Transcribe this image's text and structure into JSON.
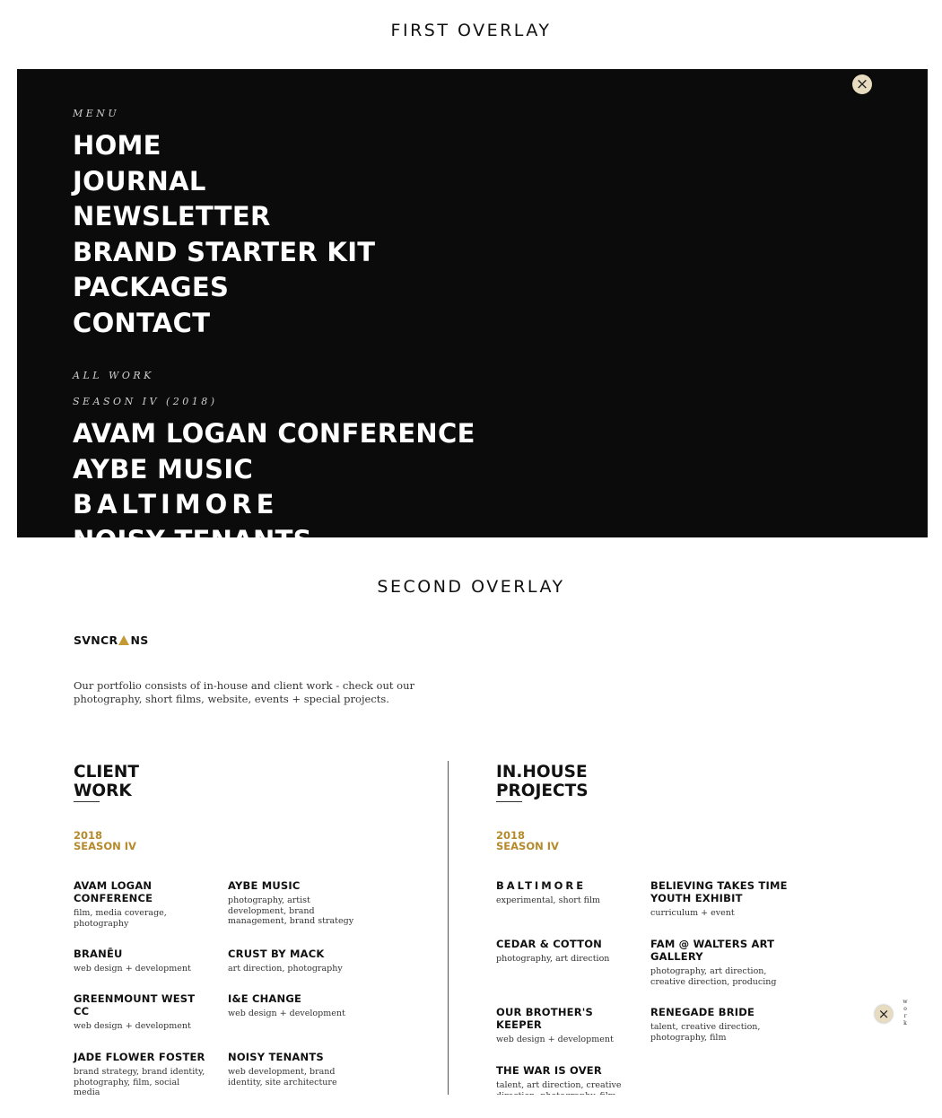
{
  "overlay1": {
    "title": "FIRST OVERLAY",
    "close_icon": "×",
    "menu_label": "MENU",
    "menu_items": [
      "HOME",
      "JOURNAL",
      "NEWSLETTER",
      "BRAND STARTER KIT",
      "PACKAGES",
      "CONTACT"
    ],
    "all_work_label": "ALL WORK",
    "season_label": "SEASON IV (2018)",
    "work_items": [
      "AVAM LOGAN CONFERENCE",
      "AYBE MUSIC",
      "BALTIMORE",
      "NOISY TENANTS"
    ]
  },
  "overlay2": {
    "title": "SECOND OVERLAY",
    "logo": {
      "before": "SVNCR",
      "after": "NS"
    },
    "intro": "Our portfolio consists of in-house and client work - check out our photography, short films, website, events + special projects.",
    "client": {
      "heading": [
        "CLIENT",
        "WORK"
      ],
      "year": "2018",
      "season": "SEASON IV",
      "projects": [
        {
          "title": "AVAM LOGAN CONFERENCE",
          "desc": "film, media coverage, photography"
        },
        {
          "title": "AYBE MUSIC",
          "desc": "photography, artist development, brand management, brand strategy"
        },
        {
          "title": "BRANĒU",
          "desc": "web design + development"
        },
        {
          "title": "CRUST BY MACK",
          "desc": "art direction, photography"
        },
        {
          "title": "GREENMOUNT WEST CC",
          "desc": "web design + development"
        },
        {
          "title": "I&E CHANGE",
          "desc": "web design + development"
        },
        {
          "title": "JADE FLOWER FOSTER",
          "desc": "brand strategy, brand identity, photography, film, social media"
        },
        {
          "title": "NOISY TENANTS",
          "desc": "web development, brand identity, site architecture"
        }
      ]
    },
    "inhouse": {
      "heading": [
        "IN.HOUSE",
        "PROJECTS"
      ],
      "year": "2018",
      "season": "SEASON IV",
      "projects": [
        {
          "title": "BALTIMORE",
          "desc": "experimental, short film"
        },
        {
          "title": "BELIEVING TAKES TIME YOUTH EXHIBIT",
          "desc": "curriculum + event"
        },
        {
          "title": "CEDAR & COTTON",
          "desc": "photography, art direction"
        },
        {
          "title": "FAM @ WALTERS ART GALLERY",
          "desc": "photography, art direction, creative direction, producing"
        },
        {
          "title": "OUR BROTHER'S KEEPER",
          "desc": "web design + development"
        },
        {
          "title": "RENEGADE BRIDE",
          "desc": "talent, creative direction, photography, film"
        },
        {
          "title": "THE WAR IS OVER",
          "desc": "talent, art direction, creative direction, photography, film"
        }
      ]
    },
    "close_icon": "×",
    "side_label": [
      "w",
      "o",
      "r",
      "k"
    ]
  }
}
